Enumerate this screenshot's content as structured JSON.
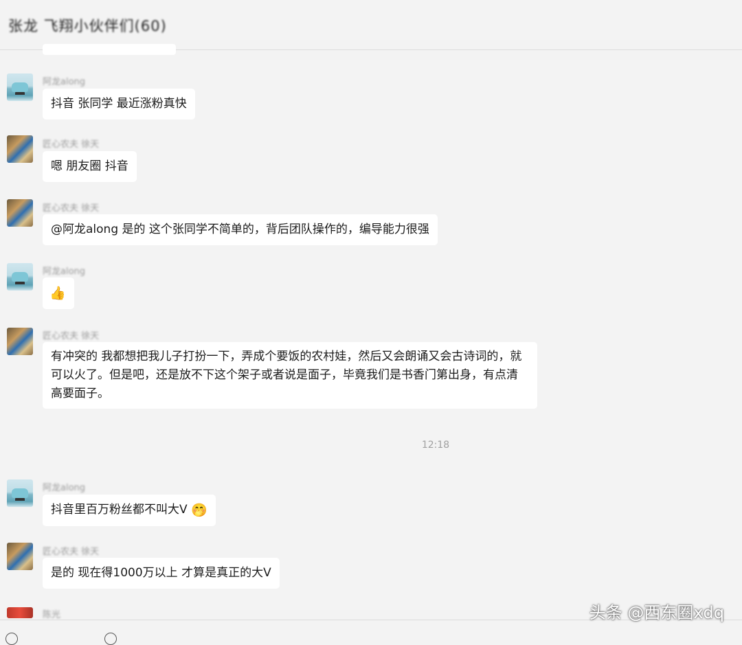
{
  "header": {
    "group_title": "张龙 飞翔小伙伴们(60)"
  },
  "messages": [
    {
      "sender": "阿龙along",
      "text": "抖音 张同学 最近涨粉真快"
    },
    {
      "sender": "匠心农夫 徐天",
      "text": "嗯 朋友圈 抖音"
    },
    {
      "sender": "匠心农夫 徐天",
      "text": "@阿龙along 是的 这个张同学不简单的，背后团队操作的，编导能力很强"
    },
    {
      "sender": "阿龙along",
      "emoji": "👍"
    },
    {
      "sender": "匠心农夫 徐天",
      "text": "有冲突的 我都想把我儿子打扮一下，弄成个要饭的农村娃，然后又会朗诵又会古诗词的，就可以火了。但是吧，还是放不下这个架子或者说是面子，毕竟我们是书香门第出身，有点清高要面子。"
    },
    {
      "sender": "阿龙along",
      "text": "抖音里百万粉丝都不叫大V",
      "emoji": "🤭"
    },
    {
      "sender": "匠心农夫 徐天",
      "text": "是的 现在得1000万以上 才算是真正的大V"
    },
    {
      "sender": "陈光"
    }
  ],
  "timestamp": "12:18",
  "watermark": "头条 @西东圈xdq"
}
